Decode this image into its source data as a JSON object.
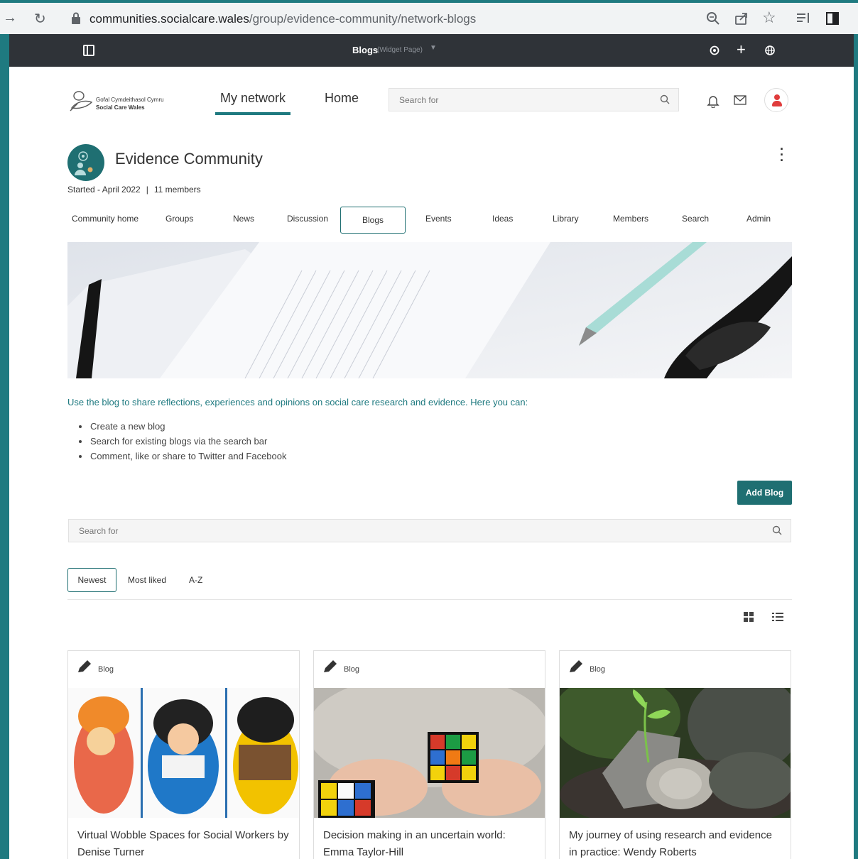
{
  "browser": {
    "url_host": "communities.socialcare.wales",
    "url_path": "/group/evidence-community/network-blogs"
  },
  "adminbar": {
    "title": "Blogs",
    "subtitle": "(Widget Page)"
  },
  "header": {
    "logo_line1": "Gofal Cymdeithasol Cymru",
    "logo_line2": "Social Care Wales",
    "nav": [
      "My network",
      "Home"
    ],
    "search_placeholder": "Search for"
  },
  "community": {
    "title": "Evidence Community",
    "started": "Started - April 2022",
    "members": "11 members",
    "tabs": [
      "Community home",
      "Groups",
      "News",
      "Discussion",
      "Blogs",
      "Events",
      "Ideas",
      "Library",
      "Members",
      "Search",
      "Admin"
    ],
    "active_tab": "Blogs"
  },
  "blogs": {
    "intro": "Use the blog to share reflections, experiences and opinions on social care research and evidence. Here you can:",
    "bullets": [
      "Create a new blog",
      "Search for existing blogs via the search bar",
      "Comment, like or share to Twitter and Facebook"
    ],
    "add_button": "Add Blog",
    "search_placeholder": "Search for",
    "sort_options": [
      "Newest",
      "Most liked",
      "A-Z"
    ],
    "active_sort": "Newest",
    "cards": [
      {
        "tag": "Blog",
        "title": "Virtual Wobble Spaces for Social Workers by Denise Turner"
      },
      {
        "tag": "Blog",
        "title": "Decision making in an uncertain world: Emma Taylor-Hill"
      },
      {
        "tag": "Blog",
        "title": "My journey of using research and evidence in practice: Wendy Roberts"
      }
    ]
  },
  "colors": {
    "accent": "#1f6f72",
    "frame": "#1f7a80",
    "adminbar": "#2f3338"
  }
}
